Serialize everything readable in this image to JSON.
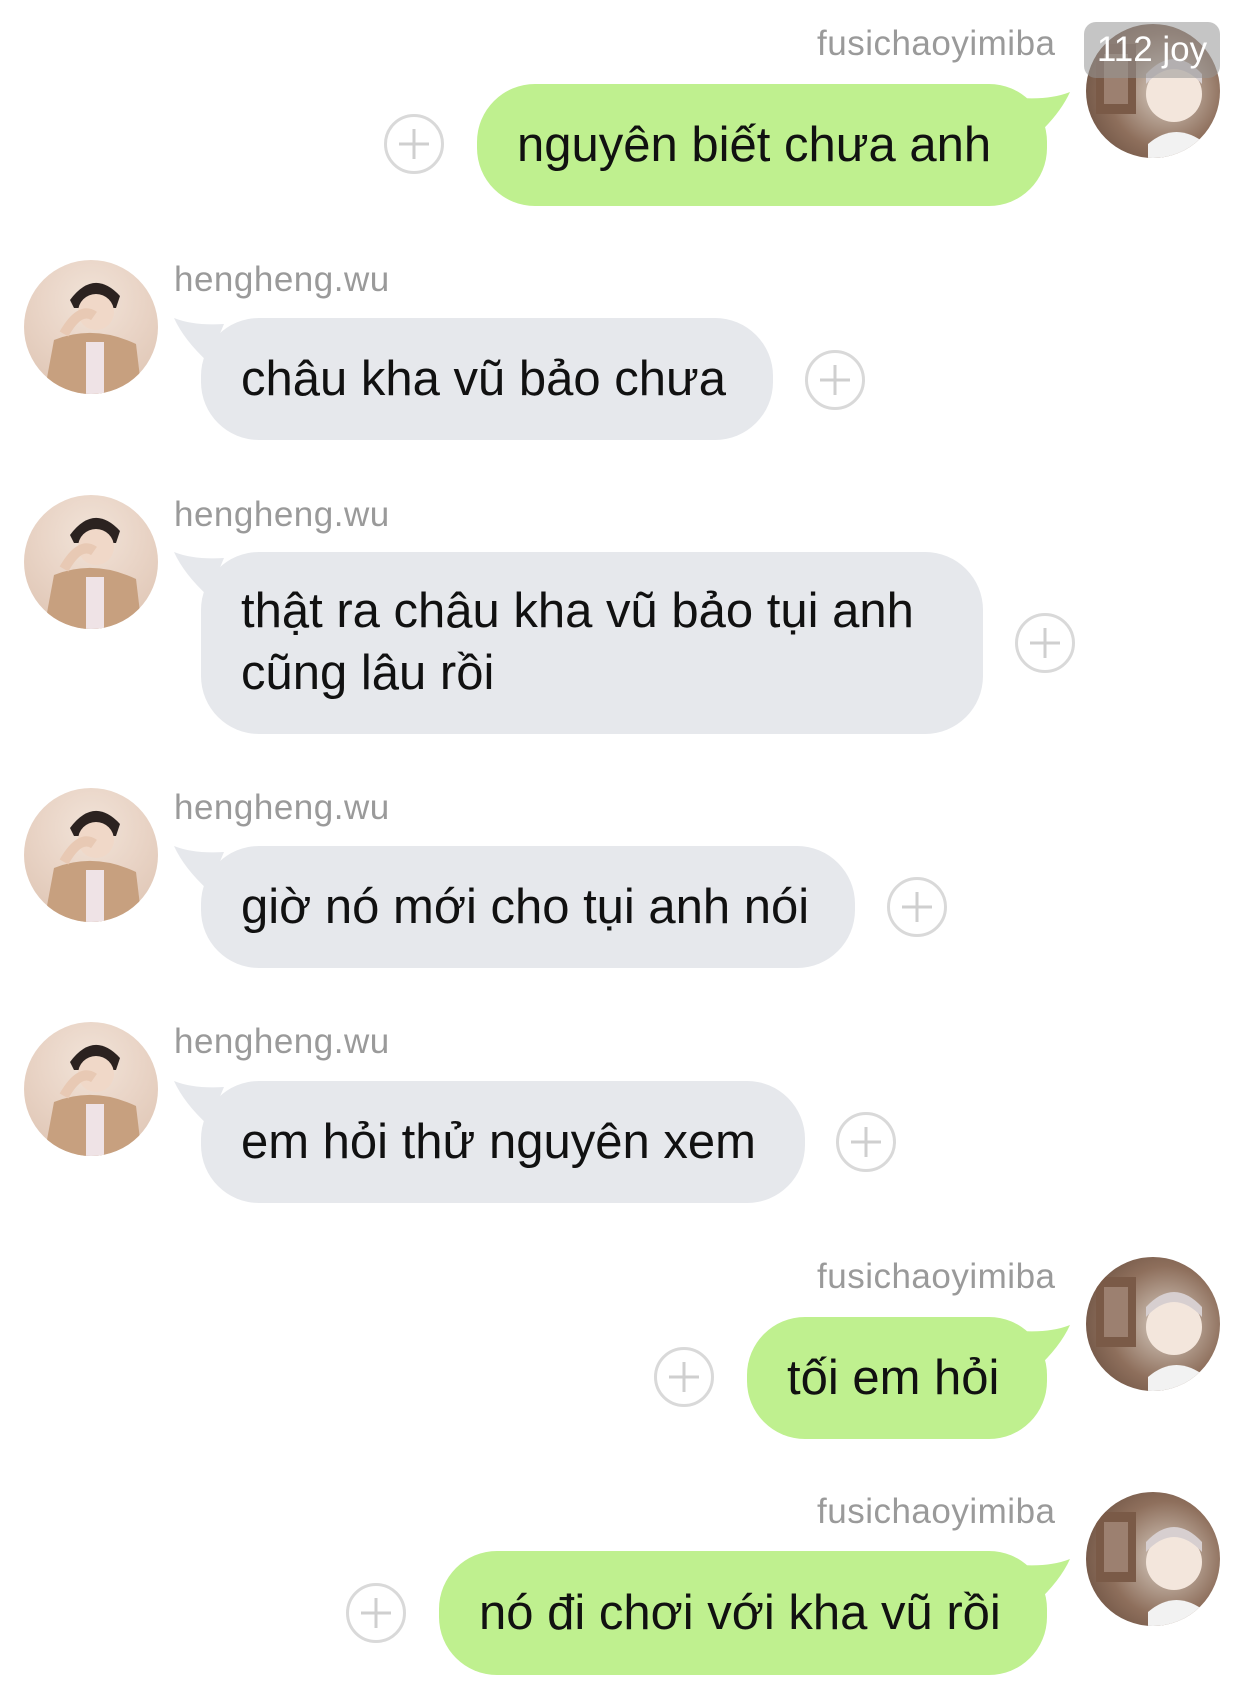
{
  "badge": "112 joy",
  "messages": [
    {
      "sender": "fusichaoyimiba",
      "text": "nguyên biết chưa anh"
    },
    {
      "sender": "hengheng.wu",
      "text": "châu kha vũ bảo chưa"
    },
    {
      "sender": "hengheng.wu",
      "line1": "thật ra châu kha vũ bảo tụi anh",
      "line2": "cũng lâu rồi"
    },
    {
      "sender": "hengheng.wu",
      "text": "giờ nó mới cho tụi anh nói"
    },
    {
      "sender": "hengheng.wu",
      "text": "em hỏi thử nguyên xem"
    },
    {
      "sender": "fusichaoyimiba",
      "text": "tối em hỏi"
    },
    {
      "sender": "fusichaoyimiba",
      "text": "nó đi chơi với kha vũ rồi"
    }
  ],
  "colors": {
    "incoming_bubble": "#e6e8ec",
    "outgoing_bubble": "#bff08f",
    "username": "#9a9a9a"
  },
  "icons": {
    "add": "plus-circle-icon",
    "avatar_other": "avatar-hengheng",
    "avatar_self": "avatar-fusichaoyimiba"
  }
}
